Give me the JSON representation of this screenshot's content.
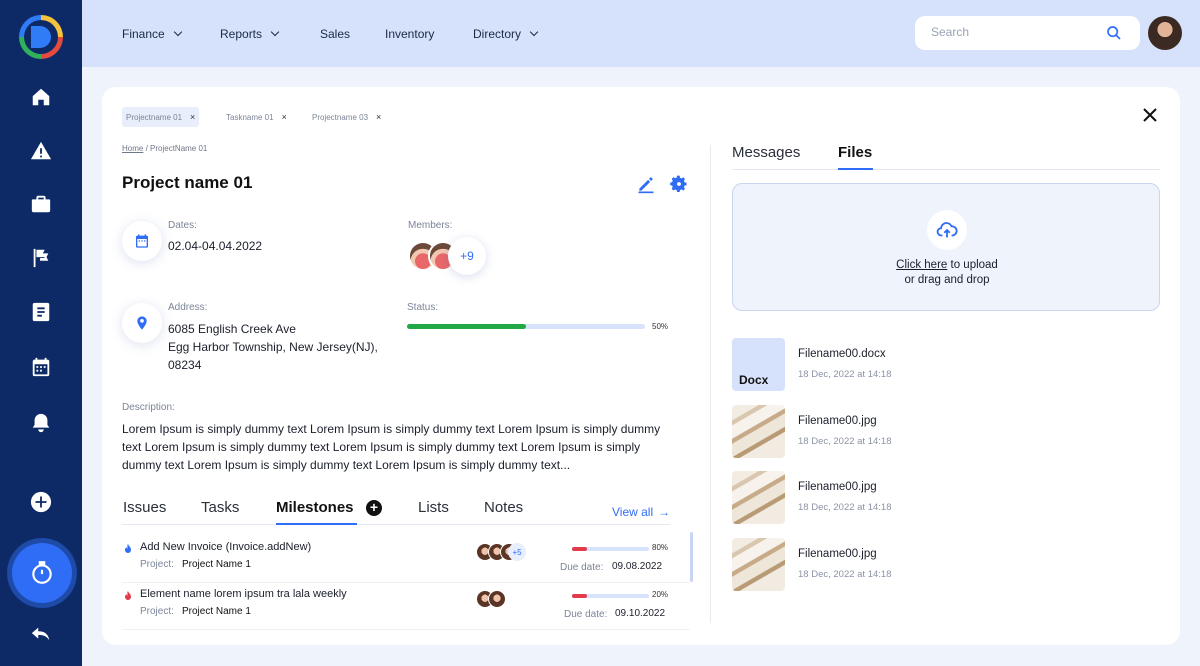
{
  "colors": {
    "sidebar": "#0d2a66",
    "topbar": "#d6e2fb",
    "accent": "#2f6df6",
    "progress_green": "#22a845",
    "progress_red": "#e23b4a"
  },
  "sidebar": {
    "icons": [
      "home-icon",
      "alert-icon",
      "briefcase-icon",
      "flag-icon",
      "document-icon",
      "calendar-icon",
      "bell-icon",
      "add-icon",
      "timer-icon",
      "back-icon"
    ]
  },
  "topnav": {
    "items": [
      {
        "label": "Finance",
        "dropdown": true
      },
      {
        "label": "Reports",
        "dropdown": true
      },
      {
        "label": "Sales",
        "dropdown": false
      },
      {
        "label": "Inventory",
        "dropdown": false
      },
      {
        "label": "Directory",
        "dropdown": true
      }
    ],
    "search_placeholder": "Search"
  },
  "chips": [
    {
      "label": "Projectname 01",
      "close": "×"
    },
    {
      "label": "Taskname 01",
      "close": "×"
    },
    {
      "label": "Projectname 03",
      "close": "×"
    }
  ],
  "breadcrumb": {
    "home": "Home",
    "sep": " / ",
    "current": "ProjectName 01"
  },
  "project": {
    "title": "Project name 01",
    "dates_label": "Dates:",
    "dates_value": "02.04-04.04.2022",
    "members_label": "Members:",
    "members_more": "+9",
    "address_label": "Address:",
    "address_line1": "6085 English Creek Ave",
    "address_line2": "Egg Harbor Township, New Jersey(NJ),",
    "address_line3": "08234",
    "status_label": "Status:",
    "status_progress": 50,
    "status_pct": "50%",
    "description_label": "Description:",
    "description": "Lorem Ipsum is simply dummy text Lorem Ipsum is simply dummy text Lorem Ipsum is simply dummy text Lorem Ipsum is simply dummy text Lorem Ipsum is simply dummy text Lorem Ipsum is simply dummy text Lorem Ipsum is simply dummy text Lorem Ipsum is simply dummy text..."
  },
  "tabs": {
    "items": [
      "Issues",
      "Tasks",
      "Milestones",
      "Lists",
      "Notes"
    ],
    "active": "Milestones",
    "view_all": "View all",
    "view_all_arrow": "→"
  },
  "milestones": [
    {
      "title": "Add New Invoice (Invoice.addNew)",
      "project_label": "Project:",
      "project": "Project Name 1",
      "members_more": "+5",
      "progress": 20,
      "pct": "80%",
      "due_label": "Due date:",
      "due": "09.08.2022",
      "icon_color": "#2f6df6"
    },
    {
      "title": "Element name lorem ipsum tra lala weekly",
      "project_label": "Project:",
      "project": "Project Name 1",
      "progress": 20,
      "pct": "20%",
      "due_label": "Due date:",
      "due": "09.10.2022",
      "icon_color": "#e23b4a"
    }
  ],
  "right": {
    "tabs": [
      "Messages",
      "Files"
    ],
    "active": "Files",
    "upload_link": "Click here",
    "upload_rest": " to upload",
    "upload_line2": "or drag and drop",
    "files": [
      {
        "name": "Filename00.docx",
        "date": "18 Dec, 2022 at 14:18",
        "thumb": "Docx"
      },
      {
        "name": "Filename00.jpg",
        "date": "18 Dec, 2022 at 14:18"
      },
      {
        "name": "Filename00.jpg",
        "date": "18 Dec, 2022 at 14:18"
      },
      {
        "name": "Filename00.jpg",
        "date": "18 Dec, 2022 at 14:18"
      }
    ]
  }
}
